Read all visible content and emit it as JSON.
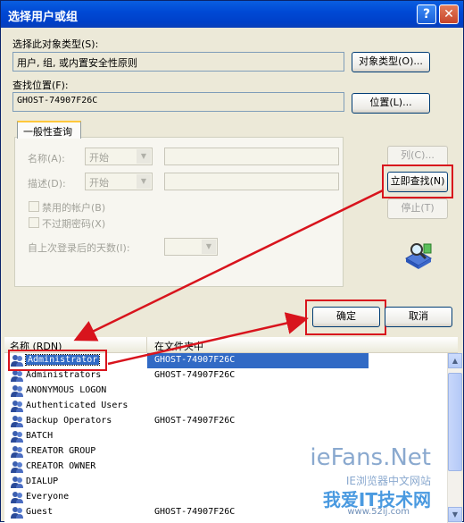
{
  "window": {
    "title": "选择用户或组",
    "help_button": "?",
    "close_button": "✕"
  },
  "object_type": {
    "label": "选择此对象类型(S):",
    "value": "用户, 组, 或内置安全性原则",
    "button": "对象类型(O)..."
  },
  "location": {
    "label": "查找位置(F):",
    "value": "GHOST-74907F26C",
    "button": "位置(L)..."
  },
  "query_tab": {
    "label": "一般性查询",
    "name_label": "名称(A):",
    "name_mode": "开始",
    "desc_label": "描述(D):",
    "desc_mode": "开始",
    "disabled_accounts": "禁用的帐户(B)",
    "non_expiring_pwd": "不过期密码(X)",
    "days_since_logon": "自上次登录后的天数(I):"
  },
  "side_buttons": {
    "columns": "列(C)...",
    "find_now": "立即查找(N)",
    "stop": "停止(T)"
  },
  "dialog_buttons": {
    "ok": "确定",
    "cancel": "取消"
  },
  "results": {
    "col_name": "名称 (RDN)",
    "col_folder": "在文件夹中",
    "rows": [
      {
        "name": "Administrator",
        "folder": "GHOST-74907F26C",
        "selected": true
      },
      {
        "name": "Administrators",
        "folder": "GHOST-74907F26C"
      },
      {
        "name": "ANONYMOUS LOGON",
        "folder": ""
      },
      {
        "name": "Authenticated Users",
        "folder": ""
      },
      {
        "name": "Backup Operators",
        "folder": "GHOST-74907F26C"
      },
      {
        "name": "BATCH",
        "folder": ""
      },
      {
        "name": "CREATOR GROUP",
        "folder": ""
      },
      {
        "name": "CREATOR OWNER",
        "folder": ""
      },
      {
        "name": "DIALUP",
        "folder": ""
      },
      {
        "name": "Everyone",
        "folder": ""
      },
      {
        "name": "Guest",
        "folder": "GHOST-74907F26C"
      }
    ]
  },
  "watermark": {
    "site": "ieFans.Net",
    "sub": "IE浏览器中文网站",
    "brand": "我爱IT技术网",
    "url": "www.52ij.com"
  },
  "colors": {
    "titlebar": "#0049d5",
    "selection": "#316ac5",
    "annotation_red": "#d8141d"
  }
}
